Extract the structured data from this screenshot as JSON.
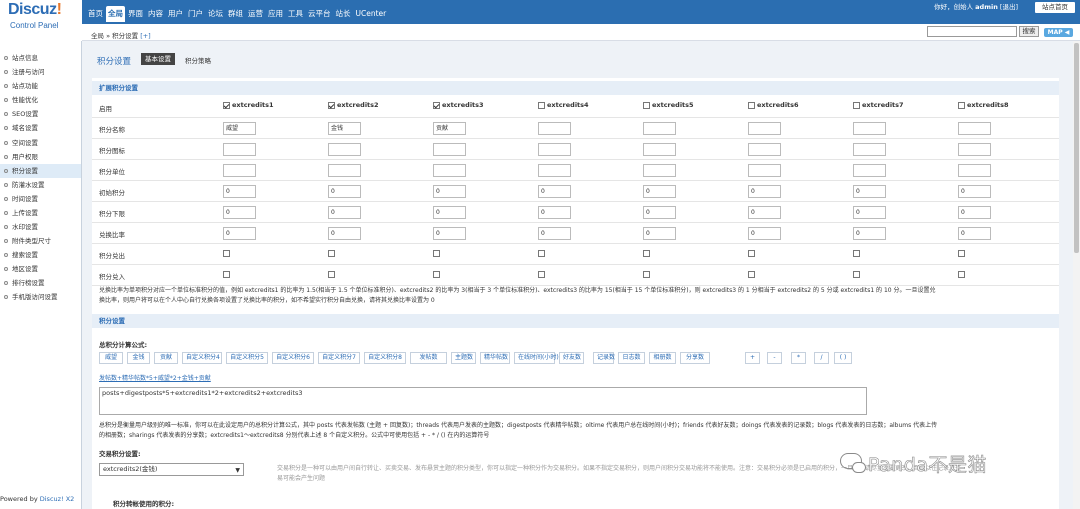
{
  "logo": {
    "brand": "Discuz",
    "bang": "!",
    "sub": "Control Panel"
  },
  "nav": [
    "首页",
    "全局",
    "界面",
    "内容",
    "用户",
    "门户",
    "论坛",
    "群组",
    "运营",
    "应用",
    "工具",
    "云平台",
    "站长",
    "UCenter"
  ],
  "nav_active_index": 1,
  "user": {
    "greeting": "你好，创始人",
    "name": "admin",
    "logout": "[退出]",
    "site_home": "站点首页"
  },
  "breadcrumb": {
    "path": "全局 » 积分设置",
    "plus": "[+]"
  },
  "search": {
    "button": "搜索",
    "map": "MAP ◀"
  },
  "sidebar": {
    "items": [
      "站点信息",
      "注册与访问",
      "站点功能",
      "性能优化",
      "SEO设置",
      "域名设置",
      "空间设置",
      "用户权限",
      "积分设置",
      "防灌水设置",
      "时间设置",
      "上传设置",
      "水印设置",
      "附件类型尺寸",
      "搜索设置",
      "地区设置",
      "排行榜设置",
      "手机版访问设置"
    ],
    "active_index": 8,
    "powered_prefix": "Powered by ",
    "powered_link": "Discuz! X2"
  },
  "page": {
    "title": "积分设置",
    "tab_basic": "基本设置",
    "tab_policy": "积分策略"
  },
  "ext": {
    "section_title": "扩展积分设置",
    "row_labels": [
      "启用",
      "积分名称",
      "积分图标",
      "积分单位",
      "初始积分",
      "积分下限",
      "兑换比率",
      "积分兑出",
      "积分兑入"
    ],
    "credits": [
      {
        "name": "extcredits1",
        "enabled": true,
        "title": "威望",
        "init": "0",
        "lower": "0",
        "ratio": "0"
      },
      {
        "name": "extcredits2",
        "enabled": true,
        "title": "金钱",
        "init": "0",
        "lower": "0",
        "ratio": "0"
      },
      {
        "name": "extcredits3",
        "enabled": true,
        "title": "贡献",
        "init": "0",
        "lower": "0",
        "ratio": "0"
      },
      {
        "name": "extcredits4",
        "enabled": false,
        "title": "",
        "init": "0",
        "lower": "0",
        "ratio": "0"
      },
      {
        "name": "extcredits5",
        "enabled": false,
        "title": "",
        "init": "0",
        "lower": "0",
        "ratio": "0"
      },
      {
        "name": "extcredits6",
        "enabled": false,
        "title": "",
        "init": "0",
        "lower": "0",
        "ratio": "0"
      },
      {
        "name": "extcredits7",
        "enabled": false,
        "title": "",
        "init": "0",
        "lower": "0",
        "ratio": "0"
      },
      {
        "name": "extcredits8",
        "enabled": false,
        "title": "",
        "init": "0",
        "lower": "0",
        "ratio": "0"
      }
    ],
    "note_line1": "兑换比率为单项积分对应一个单位标准积分的值，例如 extcredits1 的比率为 1.5(相当于 1.5 个单位标准积分)、extcredits2 的比率为 3(相当于 3 个单位标准积分)、extcredits3 的比率为 15(相当于 15 个单位标准积分)，则 extcredits3 的 1 分相当于 extcredits2 的 5 分或 extcredits1 的 10 分。一旦设置兑",
    "note_line2": "换比率，则用户将可以在个人中心自行兑换各项设置了兑换比率的积分，如不希望实行积分自由兑换，请将其兑换比率设置为 0"
  },
  "score": {
    "section_title": "积分设置",
    "formula_label": "总积分计算公式:",
    "formula_buttons": [
      "威望",
      "金钱",
      "贡献",
      "自定义积分4",
      "自定义积分5",
      "自定义积分6",
      "自定义积分7",
      "自定义积分8",
      "发帖数",
      "主题数",
      "精华帖数",
      "在线时间(小时)",
      "好友数",
      "记录数",
      "日志数",
      "相册数",
      "分享数",
      "+",
      "-",
      "*",
      "/",
      "( )"
    ],
    "formula_preview": "发帖数+精华帖数*5+威望*2+金钱+贡献",
    "formula_value": "posts+digestposts*5+extcredits1*2+extcredits2+extcredits3",
    "formula_note_1": "总积分是衡量用户级别的唯一标准，你可以在此设定用户的总积分计算公式，其中 posts 代表发帖数 (主题 + 回复数)；threads 代表用户发表的主题数；digestposts 代表精华帖数；oltime 代表用户总在线时间(小时)；friends 代表好友数；doings 代表发表的记录数；blogs 代表发表的日志数；albums 代表上传",
    "formula_note_2": "的相册数；sharings 代表发表的分享数；extcredits1～extcredits8 分别代表上述 8 个自定义积分。公式中可使用包括 + - * / () 在内的运算符号",
    "trade_label": "交易积分设置:",
    "trade_value": "extcredits2(金钱)",
    "trade_note_1": "交易积分是一种可以由用户间自行转让、买卖交易、发布悬赏主题的积分类型，你可以指定一种积分作为交易积分。如果不指定交易积分，则用户间积分交易功能将不能使用。注意：交易积分必须是已启用的积分，一旦确定请尽量不要更改，否则以往记录及交",
    "trade_note_2": "易可能会产生问题",
    "transfer_label": "积分转帐使用的积分:"
  },
  "watermark": {
    "text": "Panda不是猫"
  }
}
